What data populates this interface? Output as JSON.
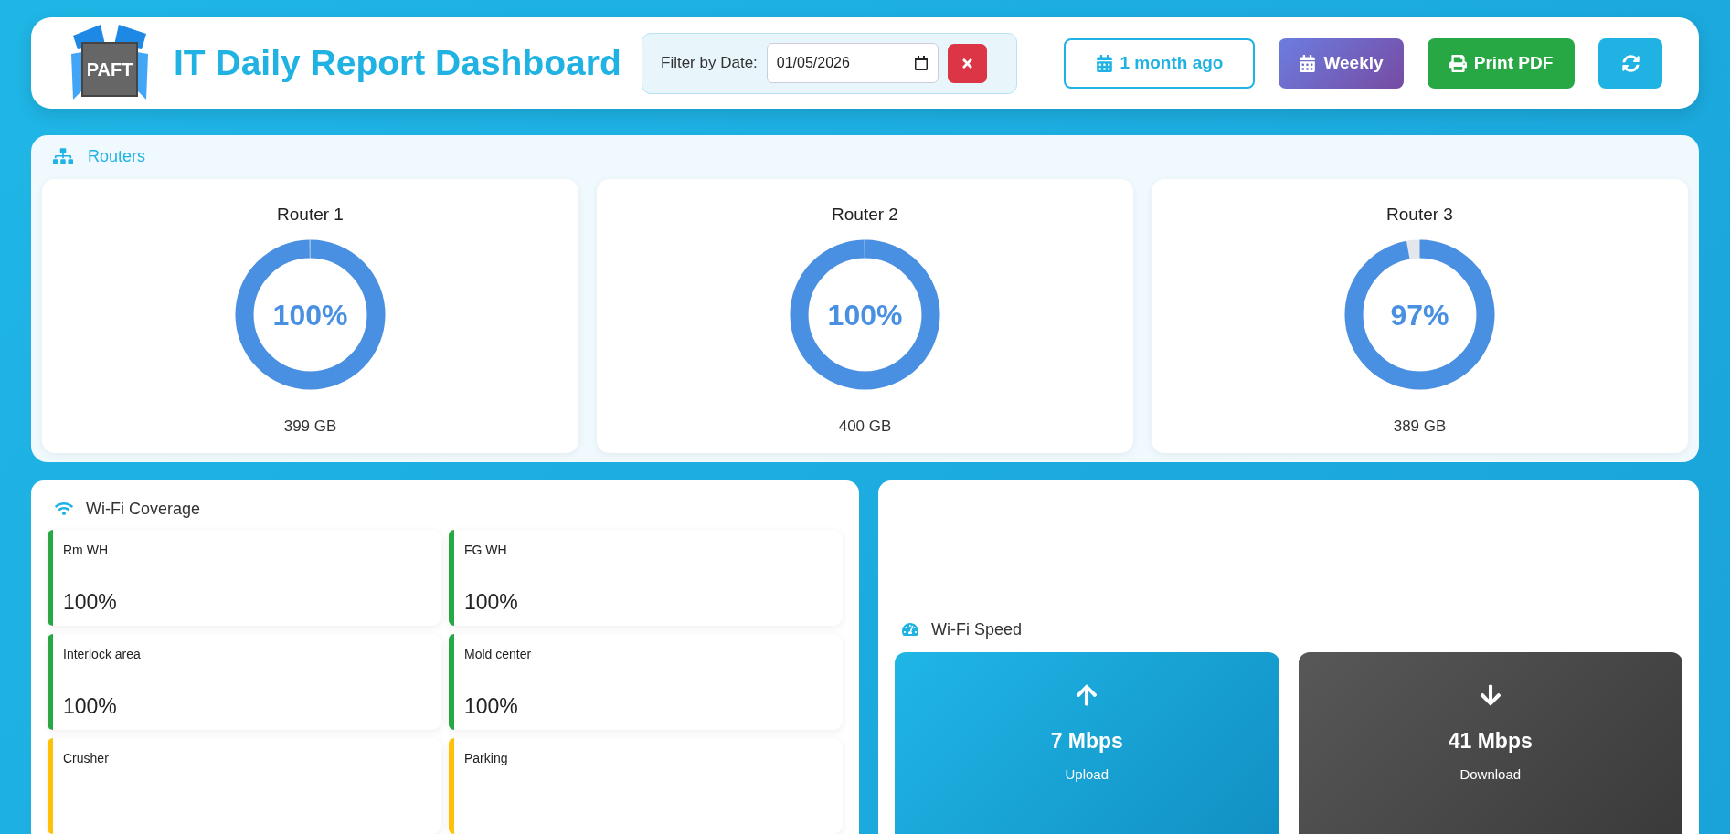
{
  "header": {
    "logo_text": "PAFT",
    "title": "IT Daily Report Dashboard",
    "filter": {
      "label": "Filter by Date:",
      "value": "01/05/2026"
    },
    "buttons": [
      {
        "kind": "outline",
        "label": "1 month ago"
      },
      {
        "kind": "purple",
        "label": "Weekly"
      },
      {
        "kind": "green",
        "label": "Print PDF"
      },
      {
        "kind": "blue"
      }
    ]
  },
  "routers": {
    "title": "Routers",
    "items": [
      {
        "name": "Router 1",
        "level": 1.0,
        "percent": "100%",
        "usage": "399 GB"
      },
      {
        "name": "Router 2",
        "level": 1.0,
        "percent": "100%",
        "usage": "400 GB"
      },
      {
        "name": "Router 3",
        "level": 0.97,
        "percent": "97%",
        "usage": "389 GB"
      }
    ]
  },
  "wifi_coverage": {
    "title": "Wi-Fi Coverage",
    "items": [
      {
        "name": "Rm WH",
        "value": "100%",
        "color": "#28a745"
      },
      {
        "name": "FG WH",
        "value": "100%",
        "color": "#28a745"
      },
      {
        "name": "Interlock area",
        "value": "100%",
        "color": "#28a745"
      },
      {
        "name": "Mold center",
        "value": "100%",
        "color": "#28a745"
      },
      {
        "name": "Crusher",
        "color": "#ffc107"
      },
      {
        "name": "Parking",
        "color": "#ffc107"
      }
    ]
  },
  "wifi_speed": {
    "title": "Wi-Fi Speed",
    "tiles": [
      {
        "kind": "upload",
        "value": "7 Mbps",
        "label": "Upload"
      },
      {
        "kind": "download",
        "value": "41 Mbps",
        "label": "Download"
      }
    ]
  }
}
